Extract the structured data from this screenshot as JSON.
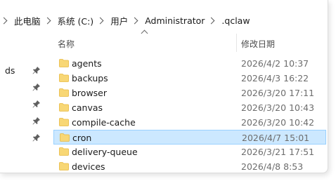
{
  "address_bar": {
    "crumbs": [
      "此电脑",
      "系统 (C:)",
      "用户",
      "Administrator",
      ".qclaw"
    ]
  },
  "columns": {
    "name": "名称",
    "modified": "修改日期"
  },
  "nav": {
    "partial_label": "ds"
  },
  "files": [
    {
      "name": "agents",
      "modified": "2026/4/2 10:37",
      "selected": false
    },
    {
      "name": "backups",
      "modified": "2026/4/3 16:22",
      "selected": false
    },
    {
      "name": "browser",
      "modified": "2026/3/20 17:11",
      "selected": false
    },
    {
      "name": "canvas",
      "modified": "2026/3/20 10:43",
      "selected": false
    },
    {
      "name": "compile-cache",
      "modified": "2026/3/20 10:42",
      "selected": false
    },
    {
      "name": "cron",
      "modified": "2026/4/7 15:01",
      "selected": true
    },
    {
      "name": "delivery-queue",
      "modified": "2026/3/21 17:51",
      "selected": false
    },
    {
      "name": "devices",
      "modified": "2026/4/8 8:53",
      "selected": false
    }
  ],
  "icons": {
    "folder": "folder-icon",
    "pin": "pin-icon",
    "chevron": "chevron-right-icon",
    "sort": "sort-ascending-icon"
  },
  "colors": {
    "folder": "#f8d775",
    "folder_dark": "#e8b93f",
    "selection_bg": "#cce8ff",
    "selection_border": "#99d1ff"
  }
}
